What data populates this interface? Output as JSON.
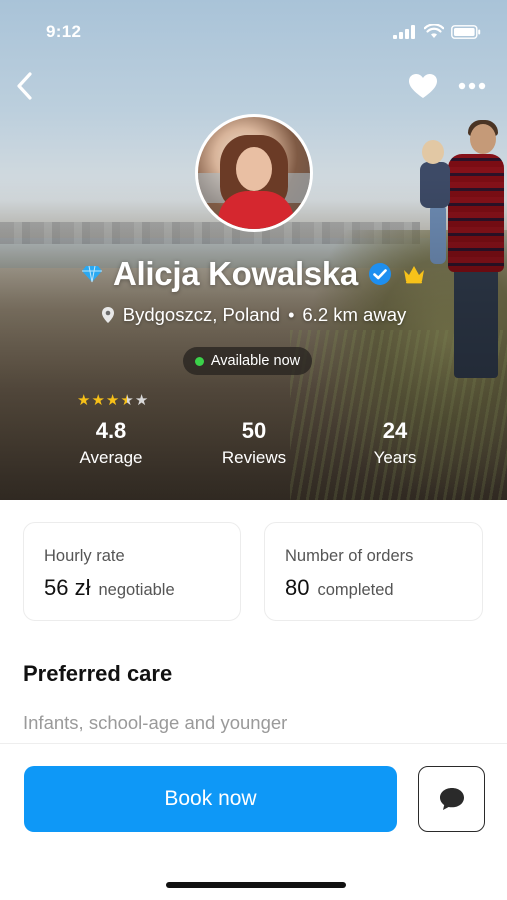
{
  "status_bar": {
    "time": "9:12"
  },
  "profile": {
    "name": "Alicja Kowalska",
    "location": "Bydgoszcz, Poland",
    "distance": "6.2 km away",
    "separator": "•",
    "availability": "Available now",
    "rating_stars": 3.5,
    "stats": [
      {
        "value": "4.8",
        "label": "Average"
      },
      {
        "value": "50",
        "label": "Reviews"
      },
      {
        "value": "24",
        "label": "Years"
      }
    ]
  },
  "cards": {
    "hourly_rate": {
      "title": "Hourly rate",
      "value": "56 zł",
      "note": "negotiable"
    },
    "orders": {
      "title": "Number of orders",
      "value": "80",
      "note": "completed"
    }
  },
  "preferred_care": {
    "title": "Preferred care",
    "text": "Infants, school-age and younger"
  },
  "actions": {
    "book_label": "Book now"
  },
  "colors": {
    "accent": "#0e98f7",
    "available": "#3bd14a",
    "star": "#f6c018",
    "verified": "#1e8ff0",
    "crown": "#f7c21a",
    "diamond": "#2aa9f2"
  },
  "icons": [
    "back-chevron-icon",
    "heart-icon",
    "more-dots-icon",
    "diamond-icon",
    "verified-badge-icon",
    "crown-icon",
    "location-pin-icon",
    "chat-bubble-icon",
    "signal-icon",
    "wifi-icon",
    "battery-icon"
  ]
}
